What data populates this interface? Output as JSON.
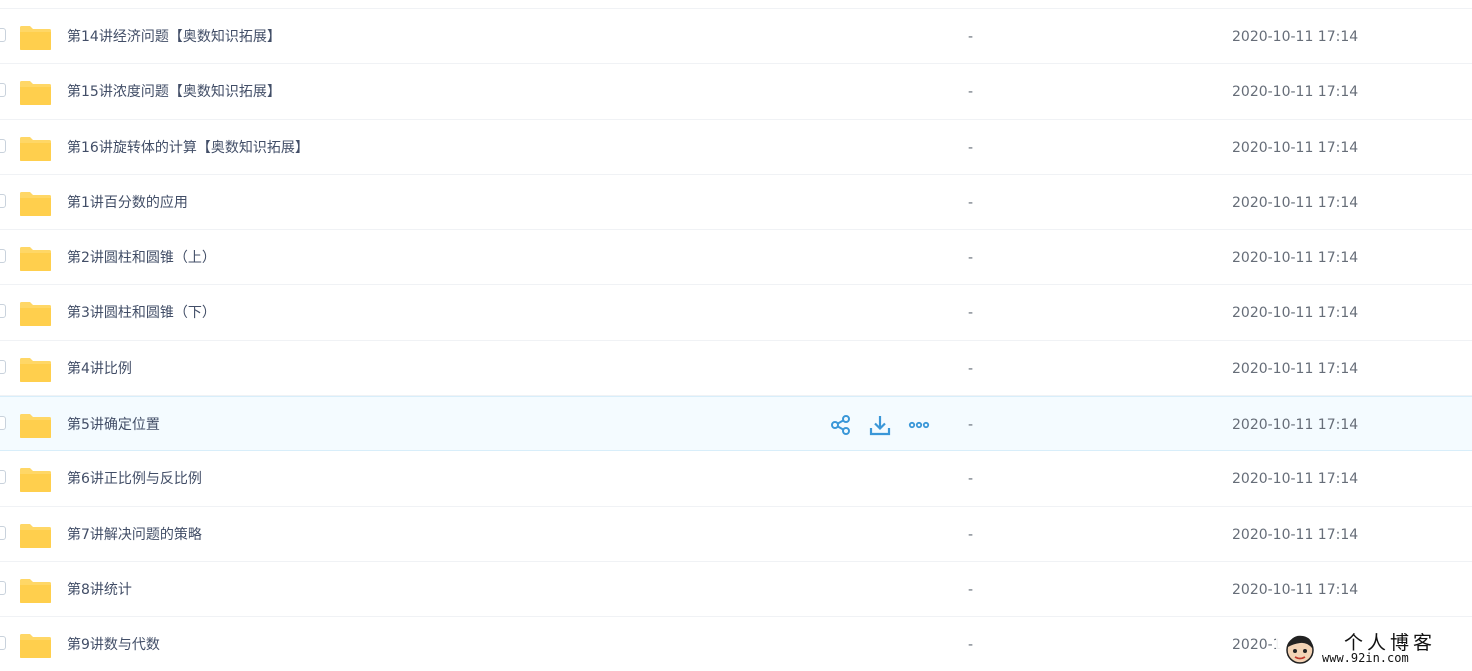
{
  "files": [
    {
      "name": "第14讲经济问题【奥数知识拓展】",
      "size": "-",
      "modified": "2020-10-11 17:14"
    },
    {
      "name": "第15讲浓度问题【奥数知识拓展】",
      "size": "-",
      "modified": "2020-10-11 17:14"
    },
    {
      "name": "第16讲旋转体的计算【奥数知识拓展】",
      "size": "-",
      "modified": "2020-10-11 17:14"
    },
    {
      "name": "第1讲百分数的应用",
      "size": "-",
      "modified": "2020-10-11 17:14"
    },
    {
      "name": "第2讲圆柱和圆锥（上）",
      "size": "-",
      "modified": "2020-10-11 17:14"
    },
    {
      "name": "第3讲圆柱和圆锥（下）",
      "size": "-",
      "modified": "2020-10-11 17:14"
    },
    {
      "name": "第4讲比例",
      "size": "-",
      "modified": "2020-10-11 17:14"
    },
    {
      "name": "第5讲确定位置",
      "size": "-",
      "modified": "2020-10-11 17:14"
    },
    {
      "name": "第6讲正比例与反比例",
      "size": "-",
      "modified": "2020-10-11 17:14"
    },
    {
      "name": "第7讲解决问题的策略",
      "size": "-",
      "modified": "2020-10-11 17:14"
    },
    {
      "name": "第8讲统计",
      "size": "-",
      "modified": "2020-10-11 17:14"
    },
    {
      "name": "第9讲数与代数",
      "size": "-",
      "modified": "2020-1"
    }
  ],
  "hovered_row": 7,
  "row_actions": [
    "share-icon",
    "download-icon",
    "more-icon"
  ],
  "colors": {
    "folder": "#ffd766",
    "action_icon": "#3a97d8",
    "hover_background": "#f4fbff",
    "text": "#424e67",
    "muted_text": "#666d78"
  },
  "watermark": {
    "title": "个人博客",
    "url": "www.92in.com"
  }
}
